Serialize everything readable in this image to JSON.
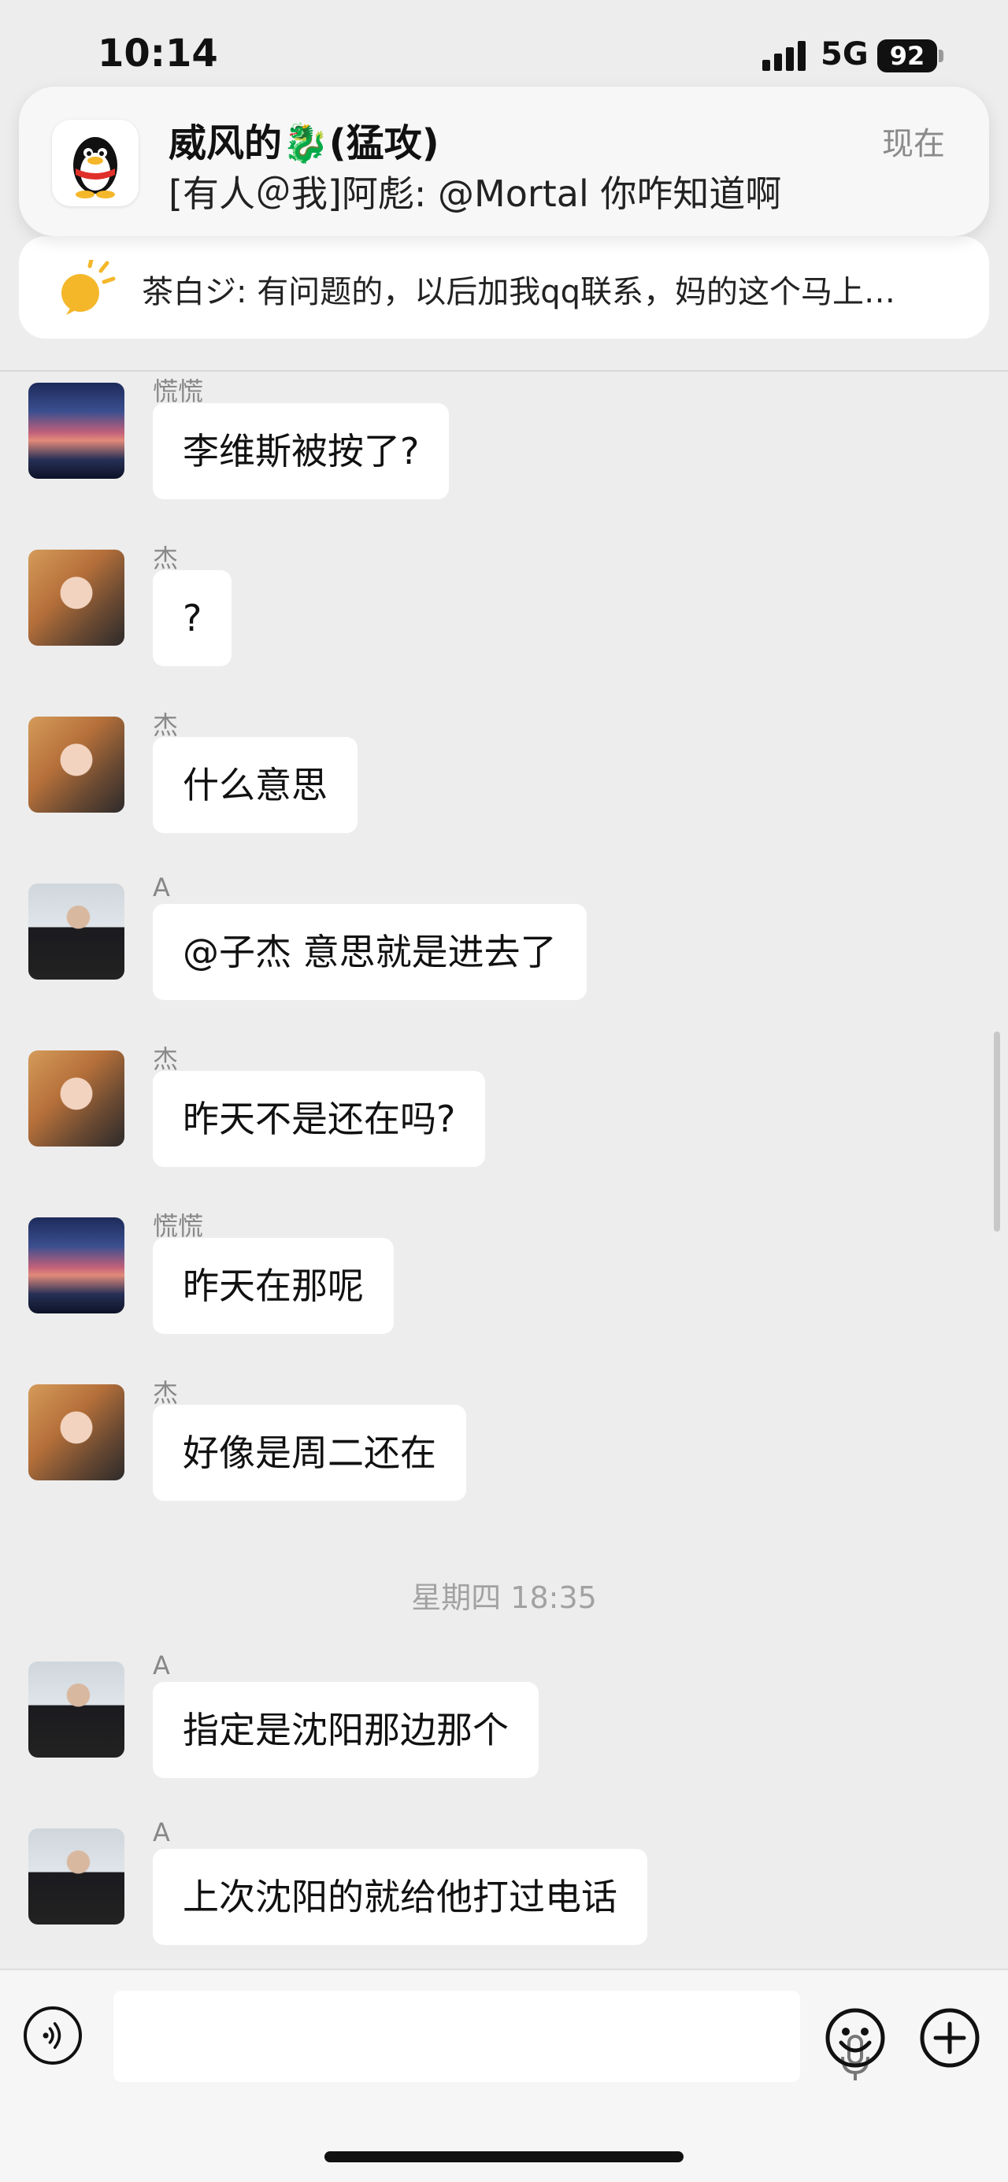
{
  "status_bar": {
    "time": "10:14",
    "network": "5G",
    "battery": "92"
  },
  "notification": {
    "title": "威风的🐉(猛攻)",
    "body": "[有人＠我]阿彪: @Mortal 你咋知道啊",
    "time": "现在"
  },
  "announcement": {
    "text": "茶白ジ: 有问题的，以后加我qq联系，妈的这个马上…"
  },
  "messages": [
    {
      "sender": "慌慌",
      "text": "李维斯被按了?",
      "avatar": "sunset"
    },
    {
      "sender": "杰",
      "text": "?",
      "avatar": "girl"
    },
    {
      "sender": "杰",
      "text": "什么意思",
      "avatar": "girl"
    },
    {
      "sender": "A",
      "text": "@子杰 意思就是进去了",
      "avatar": "man"
    },
    {
      "sender": "杰",
      "text": "昨天不是还在吗?",
      "avatar": "girl"
    },
    {
      "sender": "慌慌",
      "text": "昨天在那呢",
      "avatar": "sunset"
    },
    {
      "sender": "杰",
      "text": "好像是周二还在",
      "avatar": "girl"
    },
    {
      "sender": "A",
      "text": "指定是沈阳那边那个",
      "avatar": "man"
    },
    {
      "sender": "A",
      "text": "上次沈阳的就给他打过电话",
      "avatar": "man"
    }
  ],
  "time_divider": "星期四 18:35",
  "input_bar": {
    "placeholder": ""
  },
  "icons": [
    "qq-penguin-icon",
    "announcement-icon",
    "voice-icon",
    "mic-icon",
    "emoji-icon",
    "plus-icon"
  ]
}
